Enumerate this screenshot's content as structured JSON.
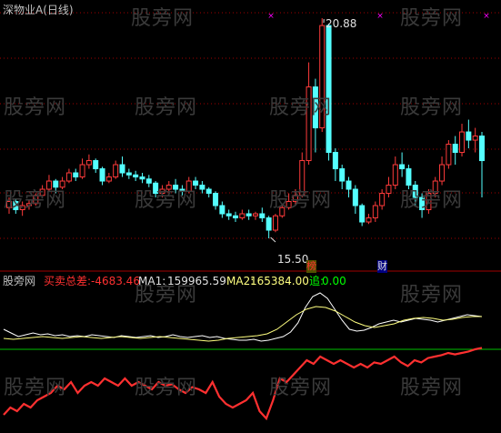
{
  "upper_panel": {
    "title": "深物业A(日线)",
    "high_label": "20.88",
    "low_label": "15.50",
    "marker_1": "榜",
    "marker_2": "财"
  },
  "lower_panel": {
    "name": "股旁网",
    "indicator_label": "买卖总差:",
    "indicator_value": "-4683.46",
    "ma1_label": "MA1:",
    "ma1_value": "159965.59",
    "ma2_label": "MA2:",
    "ma2_value": "165384.00",
    "zhui_label": "追:",
    "zhui_value": "0.00"
  },
  "watermark": "股旁网",
  "colors": {
    "up": "#ff3b3b",
    "down": "#54ffff",
    "grid": "#a00000",
    "title": "#c0c0c0",
    "label_red": "#ff3030",
    "label_white": "#e0e0e0",
    "label_green": "#00ff00",
    "ma1": "#ffffff",
    "ma2": "#ffff80",
    "zero_line": "#00c000",
    "marker": "#ff00ff"
  },
  "chart_data": {
    "type": "candlestick",
    "price_high": 20.88,
    "price_low": 15.5,
    "candles": [
      [
        16.25,
        16.4,
        16.5,
        16.1
      ],
      [
        16.4,
        16.2,
        16.45,
        16.1
      ],
      [
        16.2,
        16.3,
        16.4,
        16.05
      ],
      [
        16.3,
        16.35,
        16.45,
        16.2
      ],
      [
        16.35,
        16.55,
        16.6,
        16.3
      ],
      [
        16.55,
        16.7,
        16.8,
        16.5
      ],
      [
        16.7,
        16.9,
        17.05,
        16.65
      ],
      [
        16.9,
        16.75,
        16.95,
        16.6
      ],
      [
        16.75,
        16.9,
        17.0,
        16.7
      ],
      [
        16.9,
        17.1,
        17.2,
        16.85
      ],
      [
        17.1,
        17.0,
        17.2,
        16.9
      ],
      [
        17.0,
        17.3,
        17.45,
        16.95
      ],
      [
        17.3,
        17.4,
        17.55,
        17.2
      ],
      [
        17.4,
        17.2,
        17.45,
        17.1
      ],
      [
        17.2,
        16.9,
        17.25,
        16.8
      ],
      [
        16.9,
        17.0,
        17.1,
        16.85
      ],
      [
        17.0,
        17.3,
        17.4,
        16.95
      ],
      [
        17.3,
        17.1,
        17.5,
        17.0
      ],
      [
        17.1,
        17.05,
        17.2,
        16.95
      ],
      [
        17.05,
        17.0,
        17.15,
        16.9
      ],
      [
        17.0,
        16.95,
        17.1,
        16.85
      ],
      [
        16.95,
        16.85,
        17.05,
        16.75
      ],
      [
        16.85,
        16.6,
        16.9,
        16.5
      ],
      [
        16.6,
        16.7,
        16.8,
        16.5
      ],
      [
        16.7,
        16.8,
        16.9,
        16.6
      ],
      [
        16.8,
        16.7,
        16.95,
        16.6
      ],
      [
        16.7,
        16.65,
        16.8,
        16.55
      ],
      [
        16.65,
        16.9,
        17.0,
        16.6
      ],
      [
        16.9,
        16.8,
        17.0,
        16.7
      ],
      [
        16.8,
        16.7,
        16.9,
        16.6
      ],
      [
        16.7,
        16.6,
        16.75,
        16.5
      ],
      [
        16.6,
        16.3,
        16.65,
        16.2
      ],
      [
        16.3,
        16.1,
        16.4,
        16.0
      ],
      [
        16.1,
        16.05,
        16.2,
        15.95
      ],
      [
        16.05,
        16.0,
        16.15,
        15.9
      ],
      [
        16.0,
        16.1,
        16.2,
        15.95
      ],
      [
        16.1,
        16.05,
        16.2,
        15.95
      ],
      [
        16.05,
        16.1,
        16.15,
        15.95
      ],
      [
        16.1,
        16.0,
        16.25,
        15.9
      ],
      [
        16.0,
        15.7,
        16.05,
        15.5
      ],
      [
        15.7,
        16.05,
        16.1,
        15.65
      ],
      [
        16.05,
        16.25,
        16.35,
        16.0
      ],
      [
        16.25,
        16.4,
        16.6,
        16.2
      ],
      [
        16.4,
        16.55,
        16.7,
        16.3
      ],
      [
        16.55,
        17.4,
        17.6,
        16.5
      ],
      [
        17.4,
        19.2,
        19.8,
        17.3
      ],
      [
        19.2,
        18.2,
        19.4,
        17.6
      ],
      [
        18.2,
        20.7,
        20.88,
        18.1
      ],
      [
        20.7,
        17.6,
        20.75,
        17.4
      ],
      [
        17.6,
        17.2,
        17.7,
        16.9
      ],
      [
        17.2,
        16.9,
        17.3,
        16.7
      ],
      [
        16.9,
        16.7,
        17.0,
        16.5
      ],
      [
        16.7,
        16.3,
        16.8,
        16.1
      ],
      [
        16.3,
        15.9,
        16.35,
        15.8
      ],
      [
        15.9,
        16.0,
        16.1,
        15.85
      ],
      [
        16.0,
        16.3,
        16.4,
        15.9
      ],
      [
        16.3,
        16.6,
        16.7,
        16.2
      ],
      [
        16.6,
        16.8,
        17.0,
        16.5
      ],
      [
        16.8,
        17.3,
        17.5,
        16.7
      ],
      [
        17.3,
        17.2,
        17.6,
        17.0
      ],
      [
        17.2,
        16.8,
        17.3,
        16.7
      ],
      [
        16.8,
        16.5,
        16.9,
        16.3
      ],
      [
        16.5,
        16.2,
        16.6,
        16.0
      ],
      [
        16.2,
        16.6,
        16.7,
        16.1
      ],
      [
        16.6,
        16.9,
        17.0,
        16.5
      ],
      [
        16.9,
        17.3,
        17.5,
        16.8
      ],
      [
        17.3,
        17.8,
        17.9,
        17.2
      ],
      [
        17.8,
        17.6,
        18.0,
        17.3
      ],
      [
        17.6,
        18.1,
        18.3,
        17.5
      ],
      [
        18.1,
        17.9,
        18.4,
        17.7
      ],
      [
        17.9,
        18.0,
        18.2,
        17.6
      ],
      [
        18.0,
        17.4,
        18.1,
        16.5
      ]
    ],
    "indicator_line": [
      -9,
      -8,
      -8.5,
      -7.5,
      -8,
      -7,
      -6.5,
      -6,
      -5,
      -5.5,
      -4.5,
      -6,
      -5,
      -4.5,
      -5,
      -4,
      -4.5,
      -5,
      -4,
      -5,
      -4.5,
      -5,
      -5.5,
      -4.5,
      -5,
      -4.8,
      -5.5,
      -6,
      -5.2,
      -5.5,
      -6,
      -4.5,
      -6.5,
      -7.5,
      -8,
      -7.5,
      -7,
      -6,
      -8.5,
      -9.5,
      -7,
      -4,
      -4.5,
      -3.5,
      -2.5,
      -1.5,
      -2,
      -1,
      -1.5,
      -2,
      -1.5,
      -2,
      -2.5,
      -2,
      -2.5,
      -1.8,
      -2,
      -1.5,
      -1,
      -1.8,
      -2.3,
      -1.5,
      -1.8,
      -1.2,
      -1,
      -0.8,
      -0.5,
      -0.7,
      -0.5,
      -0.3,
      0,
      0.2
    ]
  }
}
